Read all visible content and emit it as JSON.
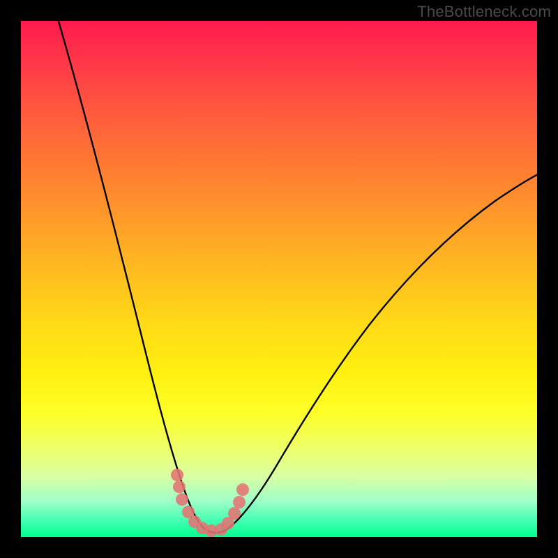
{
  "watermark": "TheBottleneck.com",
  "chart_data": {
    "type": "line",
    "title": "",
    "xlabel": "",
    "ylabel": "",
    "xlim": [
      0,
      100
    ],
    "ylim": [
      0,
      100
    ],
    "grid": false,
    "legend": false,
    "series": [
      {
        "name": "curve",
        "x": [
          5,
          10,
          15,
          20,
          25,
          28,
          30,
          32,
          34,
          36,
          40,
          45,
          50,
          55,
          60,
          65,
          70,
          75,
          80,
          85,
          90,
          95,
          100
        ],
        "y": [
          102,
          80,
          60,
          42,
          26,
          16,
          10,
          5,
          2,
          1,
          2,
          6,
          12,
          19,
          27,
          35,
          43,
          51,
          58,
          64,
          69,
          73,
          76
        ]
      }
    ],
    "marker_cluster": {
      "name": "bottom-dots",
      "approx_x_range": [
        29,
        41
      ],
      "approx_y_range": [
        0,
        9
      ],
      "count": 12
    },
    "background_gradient": {
      "top": "#ff1a4d",
      "mid": "#fff010",
      "bottom": "#00ff90"
    }
  }
}
